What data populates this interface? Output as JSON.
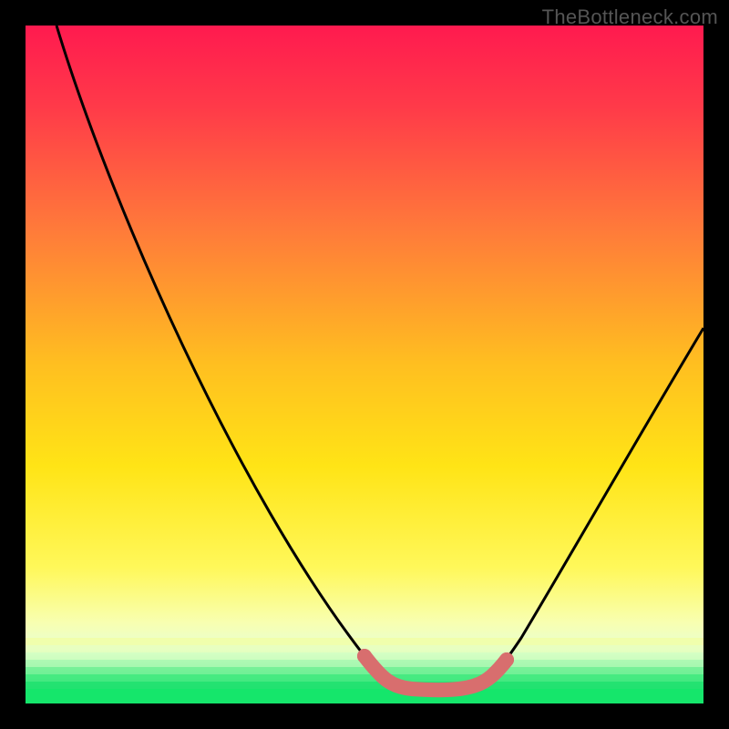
{
  "watermark": "TheBottleneck.com",
  "colors": {
    "black": "#000000",
    "grad_top": "#ff1a44",
    "grad_mid": "#ffd900",
    "grad_bottom_yellow": "#fbff90",
    "grad_green": "#15e66b",
    "curve": "#000000",
    "marker": "#d86e6e"
  },
  "chart_data": {
    "type": "line",
    "title": "",
    "xlabel": "",
    "ylabel": "",
    "xlim": [
      0,
      100
    ],
    "ylim": [
      0,
      100
    ],
    "series": [
      {
        "name": "curve",
        "x": [
          5,
          10,
          15,
          20,
          25,
          30,
          35,
          40,
          45,
          50,
          52,
          55,
          58,
          62,
          65,
          68,
          72,
          78,
          84,
          90,
          96
        ],
        "y": [
          100,
          90,
          80,
          70,
          60,
          50,
          40,
          30,
          20,
          10,
          6,
          3,
          2,
          2,
          3,
          6,
          12,
          22,
          34,
          46,
          58
        ]
      },
      {
        "name": "marker-band",
        "x": [
          52,
          55,
          58,
          62,
          65,
          68
        ],
        "y": [
          6,
          3,
          2,
          2,
          3,
          6
        ]
      }
    ],
    "annotations": [
      {
        "text": "TheBottleneck.com",
        "pos": "top-right"
      }
    ]
  }
}
